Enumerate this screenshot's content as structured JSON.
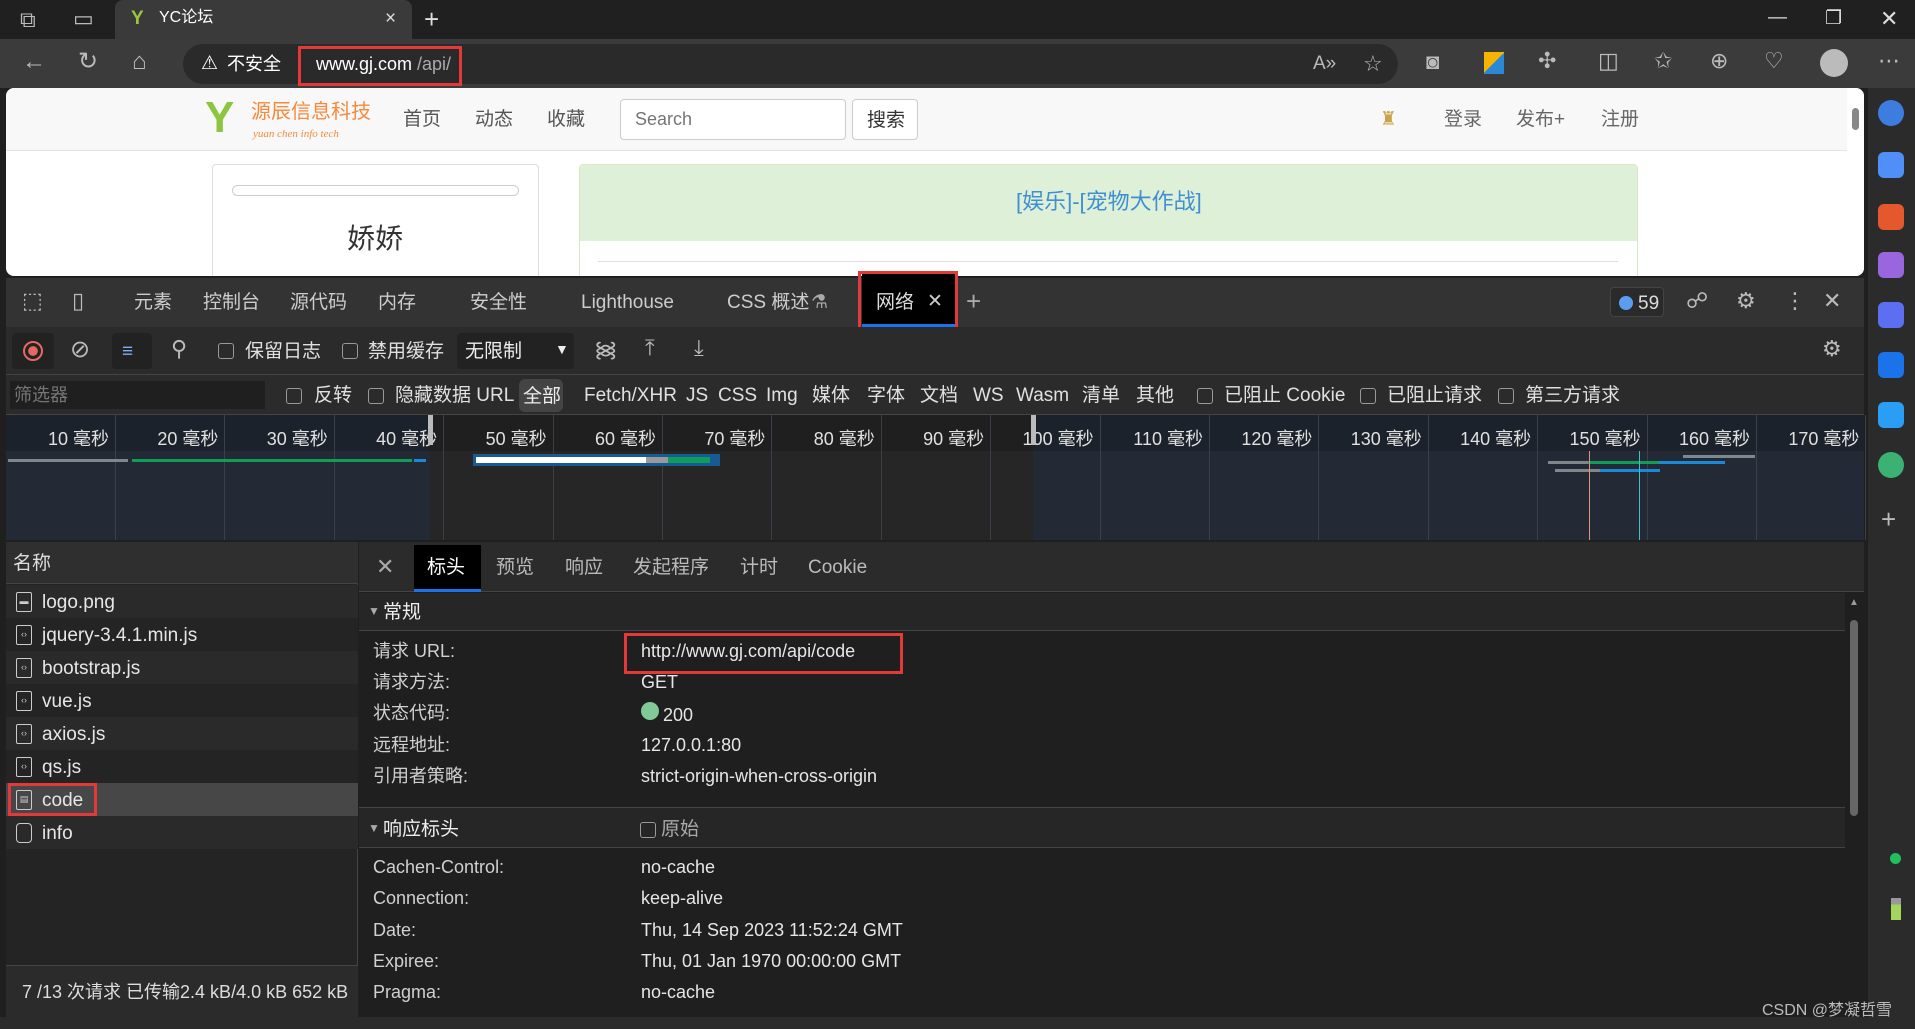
{
  "browser": {
    "tab_title": "YC论坛",
    "insecure_label": "不安全",
    "url_host": "www.gj.com",
    "url_path": "/api/",
    "close_tab": "×",
    "new_tab": "+"
  },
  "page": {
    "logo_text": "源辰信息科技",
    "logo_sub": "yuan chen info tech",
    "nav": [
      "首页",
      "动态",
      "收藏"
    ],
    "search_placeholder": "Search",
    "search_button": "搜索",
    "right_nav": [
      "登录",
      "发布+",
      "注册"
    ],
    "user_name": "娇娇",
    "post_title": "[娱乐]-[宠物大作战]"
  },
  "devtools": {
    "tabs": [
      "元素",
      "控制台",
      "源代码",
      "内存",
      "安全性",
      "Lighthouse",
      "CSS 概述",
      "网络"
    ],
    "active_tab": "网络",
    "issues_count": "59",
    "toolbar": {
      "preserve_log": "保留日志",
      "disable_cache": "禁用缓存",
      "throttle": "无限制"
    },
    "filter": {
      "placeholder": "筛选器",
      "invert": "反转",
      "hide_data_url": "隐藏数据 URL",
      "types": [
        "全部",
        "Fetch/XHR",
        "JS",
        "CSS",
        "Img",
        "媒体",
        "字体",
        "文档",
        "WS",
        "Wasm",
        "清单",
        "其他"
      ],
      "blocked_cookies": "已阻止 Cookie",
      "blocked_requests": "已阻止请求",
      "third_party": "第三方请求"
    },
    "timeline_ticks": [
      "10 毫秒",
      "20 毫秒",
      "30 毫秒",
      "40 毫秒",
      "50 毫秒",
      "60 毫秒",
      "70 毫秒",
      "80 毫秒",
      "90 毫秒",
      "100 毫秒",
      "110 毫秒",
      "120 毫秒",
      "130 毫秒",
      "140 毫秒",
      "150 毫秒",
      "160 毫秒",
      "170 毫秒"
    ],
    "requests": {
      "header": "名称",
      "items": [
        {
          "name": "logo.png",
          "type": "image"
        },
        {
          "name": "jquery-3.4.1.min.js",
          "type": "script"
        },
        {
          "name": "bootstrap.js",
          "type": "script"
        },
        {
          "name": "vue.js",
          "type": "script"
        },
        {
          "name": "axios.js",
          "type": "script"
        },
        {
          "name": "qs.js",
          "type": "script"
        },
        {
          "name": "code",
          "type": "document",
          "selected": true
        },
        {
          "name": "info",
          "type": "other"
        }
      ],
      "summary": "7 /13 次请求  已传输2.4 kB/4.0 kB  652 kB"
    },
    "detail": {
      "tabs": [
        "标头",
        "预览",
        "响应",
        "发起程序",
        "计时",
        "Cookie"
      ],
      "active_tab": "标头",
      "general_title": "常规",
      "general": [
        {
          "key": "请求 URL:",
          "value": "http://www.gj.com/api/code"
        },
        {
          "key": "请求方法:",
          "value": "GET"
        },
        {
          "key": "状态代码:",
          "value": "200"
        },
        {
          "key": "远程地址:",
          "value": "127.0.0.1:80"
        },
        {
          "key": "引用者策略:",
          "value": "strict-origin-when-cross-origin"
        }
      ],
      "response_title": "响应标头",
      "raw_label": "原始",
      "response_headers": [
        {
          "key": "Cachen-Control:",
          "value": "no-cache"
        },
        {
          "key": "Connection:",
          "value": "keep-alive"
        },
        {
          "key": "Date:",
          "value": "Thu, 14 Sep 2023 11:52:24 GMT"
        },
        {
          "key": "Expiree:",
          "value": "Thu, 01 Jan 1970 00:00:00 GMT"
        },
        {
          "key": "Pragma:",
          "value": "no-cache"
        }
      ]
    }
  },
  "watermark": "CSDN @梦凝哲雪",
  "colors": {
    "accent": "#1a73e8",
    "highlight": "#e23a3a",
    "status_ok": "#81c995",
    "link": "#3f8fd2"
  }
}
